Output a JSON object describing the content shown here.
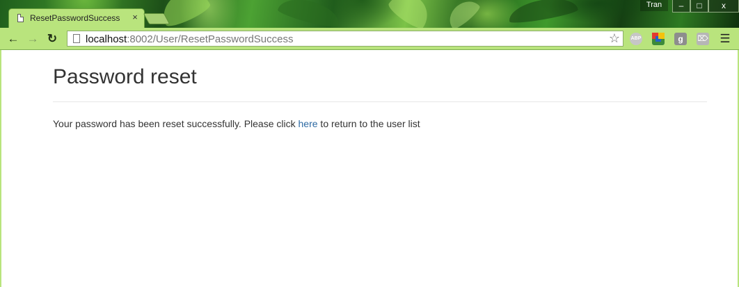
{
  "browser": {
    "tab": {
      "title": "ResetPasswordSuccess",
      "close_glyph": "×"
    },
    "profile_name": "Tran",
    "window_controls": {
      "minimize": "–",
      "maximize": "□",
      "close": "x"
    },
    "toolbar": {
      "back_icon": "arrow-left-icon",
      "forward_icon": "arrow-right-icon",
      "reload_icon": "reload-icon",
      "url_host": "localhost",
      "url_rest": ":8002/User/ResetPasswordSuccess",
      "bookmark_icon": "star-icon",
      "extensions": [
        {
          "name": "adblock-plus",
          "label": "ABP"
        },
        {
          "name": "google-analytics",
          "label": ""
        },
        {
          "name": "google-plus",
          "label": "g"
        },
        {
          "name": "rss",
          "label": ""
        }
      ],
      "menu_icon": "hamburger-menu-icon"
    },
    "theme_colors": {
      "toolbar": "#b9e47d",
      "link": "#2d6aa3"
    }
  },
  "page": {
    "heading": "Password reset",
    "message_before": "Your password has been reset successfully. Please click ",
    "link_text": "here",
    "message_after": " to return to the user list"
  }
}
